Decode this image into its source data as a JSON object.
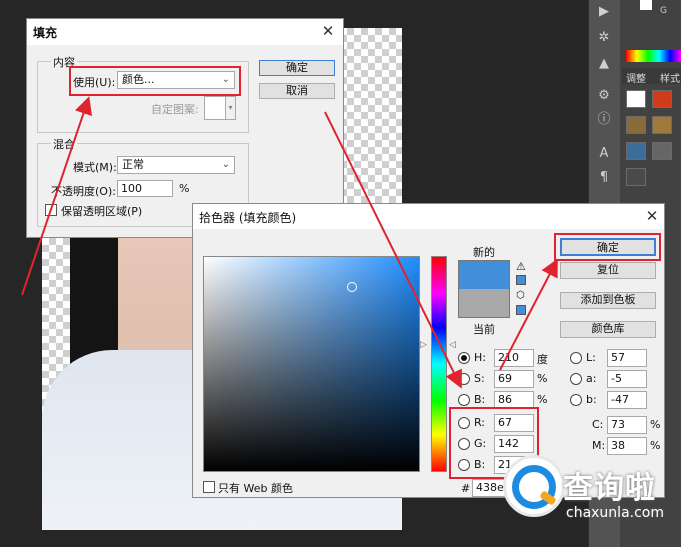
{
  "fill_dialog": {
    "title": "填充",
    "close": "✕",
    "content_group": "内容",
    "use_label": "使用(U):",
    "use_value": "颜色...",
    "custom_pattern_label": "自定图案:",
    "ok": "确定",
    "cancel": "取消",
    "blend_group": "混合",
    "mode_label": "模式(M):",
    "mode_value": "正常",
    "opacity_label": "不透明度(O):",
    "opacity_value": "100",
    "opacity_unit": "%",
    "preserve_label": "保留透明区域(P)"
  },
  "picker": {
    "title": "拾色器 (填充颜色)",
    "close": "✕",
    "new_label": "新的",
    "current_label": "当前",
    "ok": "确定",
    "reset": "复位",
    "add_swatch": "添加到色板",
    "color_libraries": "颜色库",
    "web_only_label": "只有 Web 颜色",
    "new_color": "#438ed9",
    "current_color": "#a9a9a9",
    "hsb": [
      {
        "label": "H:",
        "value": "210",
        "unit": "度"
      },
      {
        "label": "S:",
        "value": "69",
        "unit": "%"
      },
      {
        "label": "B:",
        "value": "86",
        "unit": "%"
      }
    ],
    "rgb": [
      {
        "label": "R:",
        "value": "67"
      },
      {
        "label": "G:",
        "value": "142"
      },
      {
        "label": "B:",
        "value": "21"
      }
    ],
    "lab": [
      {
        "label": "L:",
        "value": "57"
      },
      {
        "label": "a:",
        "value": "-5"
      },
      {
        "label": "b:",
        "value": "-47"
      }
    ],
    "cmyk": [
      {
        "label": "C:",
        "value": "73",
        "unit": "%"
      },
      {
        "label": "M:",
        "value": "38",
        "unit": "%"
      }
    ],
    "hex_label": "#",
    "hex_value": "438ec"
  },
  "right_panel": {
    "tab_adjust": "调整",
    "tab_style": "样式",
    "swatch_letter": "G"
  },
  "watermark": {
    "text": "查询啦",
    "url": "chaxunla.com"
  },
  "colors": {
    "highlight_red": "#e0242f",
    "accent_blue": "#1d8be0"
  }
}
